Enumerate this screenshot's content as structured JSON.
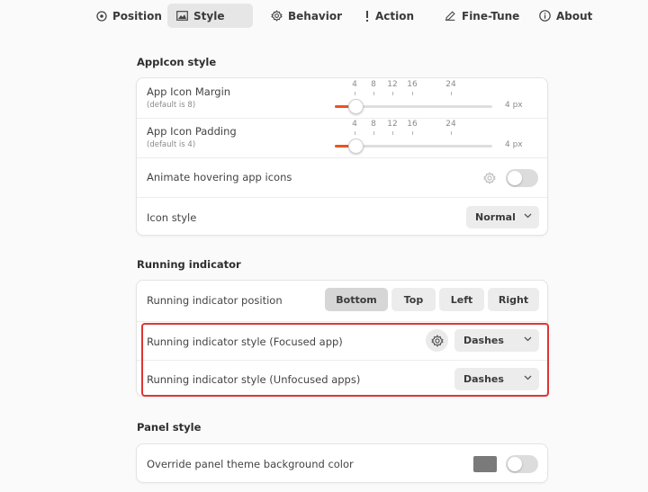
{
  "tabs": [
    {
      "label": "Position",
      "icon": "position-icon"
    },
    {
      "label": "Style",
      "icon": "style-icon",
      "active": true
    },
    {
      "label": "Behavior",
      "icon": "behavior-icon"
    },
    {
      "label": "Action",
      "icon": "action-icon"
    },
    {
      "label": "Fine-Tune",
      "icon": "fine-tune-icon"
    },
    {
      "label": "About",
      "icon": "about-icon"
    }
  ],
  "appicon_section": {
    "title": "AppIcon style",
    "margin": {
      "label": "App Icon Margin",
      "sublabel": "(default is 8)",
      "ticks": [
        "4",
        "8",
        "12",
        "16",
        "24"
      ],
      "value_text": "4 px",
      "value": 4,
      "min": 0,
      "max": 32
    },
    "padding": {
      "label": "App Icon Padding",
      "sublabel": "(default is 4)",
      "ticks": [
        "4",
        "8",
        "12",
        "16",
        "24"
      ],
      "value_text": "4 px",
      "value": 4,
      "min": 0,
      "max": 32
    },
    "animate_hover": {
      "label": "Animate hovering app icons",
      "enabled": false
    },
    "icon_style": {
      "label": "Icon style",
      "value": "Normal"
    }
  },
  "running_section": {
    "title": "Running indicator",
    "position": {
      "label": "Running indicator position",
      "options": [
        "Bottom",
        "Top",
        "Left",
        "Right"
      ],
      "selected": "Bottom"
    },
    "focused": {
      "label": "Running indicator style (Focused app)",
      "value": "Dashes"
    },
    "unfocused": {
      "label": "Running indicator style (Unfocused apps)",
      "value": "Dashes"
    }
  },
  "panel_section": {
    "title": "Panel style",
    "override_bg": {
      "label": "Override panel theme background color",
      "enabled": false,
      "swatch_color": "#7a7a7a"
    }
  },
  "colors": {
    "accent": "#e95420",
    "highlight": "#e03535"
  }
}
